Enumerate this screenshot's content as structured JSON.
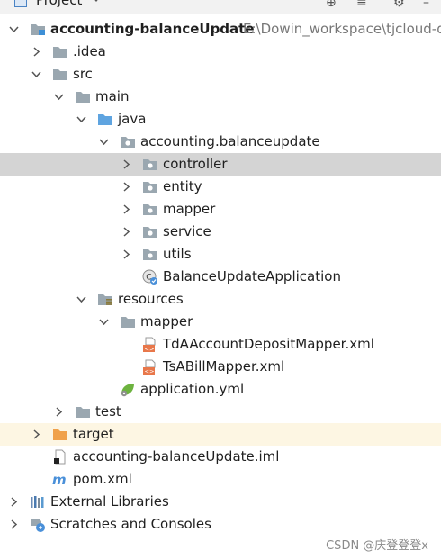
{
  "panel": {
    "title": "Project"
  },
  "tree": [
    {
      "label": "accounting-balanceUpdate",
      "path": "E:\\Dowin_workspace\\tjcloud-d",
      "icon": "module-folder-icon",
      "expanded": true
    },
    {
      "label": ".idea",
      "icon": "folder-icon",
      "expanded": false
    },
    {
      "label": "src",
      "icon": "folder-icon",
      "expanded": true
    },
    {
      "label": "main",
      "icon": "folder-icon",
      "expanded": true
    },
    {
      "label": "java",
      "icon": "source-folder-icon",
      "expanded": true
    },
    {
      "label": "accounting.balanceupdate",
      "icon": "package-icon",
      "expanded": true
    },
    {
      "label": "controller",
      "icon": "package-icon",
      "expanded": false,
      "selected": true
    },
    {
      "label": "entity",
      "icon": "package-icon",
      "expanded": false
    },
    {
      "label": "mapper",
      "icon": "package-icon",
      "expanded": false
    },
    {
      "label": "service",
      "icon": "package-icon",
      "expanded": false
    },
    {
      "label": "utils",
      "icon": "package-icon",
      "expanded": false
    },
    {
      "label": "BalanceUpdateApplication",
      "icon": "spring-boot-class-icon"
    },
    {
      "label": "resources",
      "icon": "resources-folder-icon",
      "expanded": true
    },
    {
      "label": "mapper",
      "icon": "folder-icon",
      "expanded": true
    },
    {
      "label": "TdAAccountDepositMapper.xml",
      "icon": "xml-file-icon"
    },
    {
      "label": "TsABillMapper.xml",
      "icon": "xml-file-icon"
    },
    {
      "label": "application.yml",
      "icon": "spring-yml-icon"
    },
    {
      "label": "test",
      "icon": "folder-icon",
      "expanded": false
    },
    {
      "label": "target",
      "icon": "excluded-folder-icon",
      "expanded": false
    },
    {
      "label": "accounting-balanceUpdate.iml",
      "icon": "iml-file-icon"
    },
    {
      "label": "pom.xml",
      "icon": "maven-icon"
    },
    {
      "label": "External Libraries",
      "icon": "libraries-icon",
      "expanded": false
    },
    {
      "label": "Scratches and Consoles",
      "icon": "scratches-icon",
      "expanded": false
    }
  ],
  "watermark": "CSDN @庆登登登x",
  "colors": {
    "selection": "#d4d4d4",
    "excluded_row": "#fdf6e3",
    "folder": "#9aa7b0",
    "excluded_folder": "#f0a14a",
    "spring": "#6db33f"
  }
}
